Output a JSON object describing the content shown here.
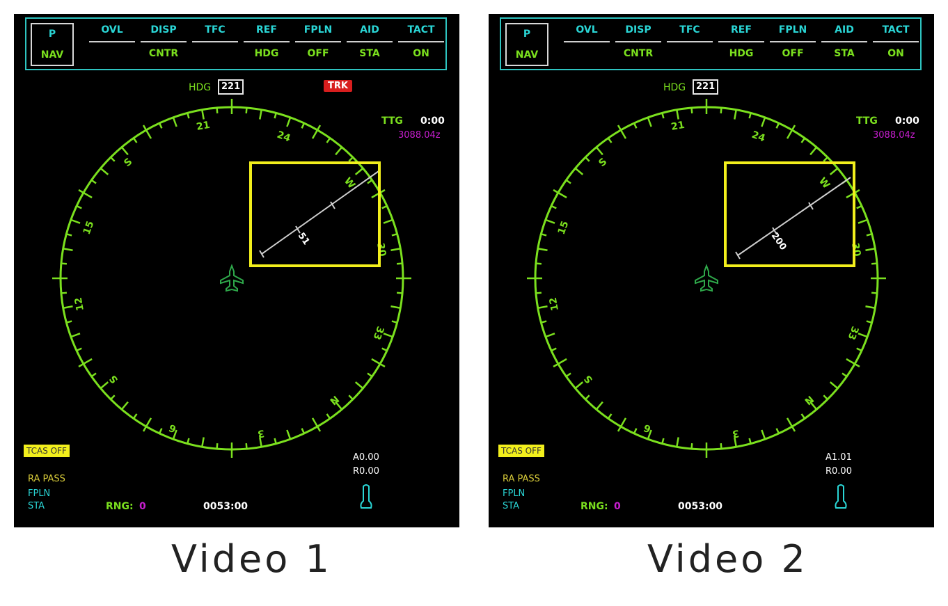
{
  "panels": [
    {
      "menu": {
        "p": "P",
        "nav": "NAV",
        "top": [
          "OVL",
          "DISP",
          "TFC",
          "REF",
          "FPLN",
          "AID",
          "TACT"
        ],
        "bottom": [
          "",
          "CNTR",
          "",
          "HDG",
          "OFF",
          "STA",
          "ON"
        ]
      },
      "hdg_label": "HDG",
      "hdg_value": "221",
      "trk": "TRK",
      "ttg_label": "TTG",
      "ttg_value": "0:00",
      "time_magenta": "3088.04z",
      "route_label": "51",
      "compass_labels": [
        "21",
        "24",
        "W",
        "30",
        "33",
        "N",
        "3",
        "6",
        "S",
        "12",
        "15",
        "S"
      ],
      "tcas": "TCAS OFF",
      "ra_pass": "RA PASS",
      "fpln": "FPLN",
      "sta": "STA",
      "rng_label": "RNG:",
      "rng_value": "0",
      "clock": "0053:00",
      "a_value": "A0.00",
      "r_value": "R0.00",
      "caption": "Video 1"
    },
    {
      "menu": {
        "p": "P",
        "nav": "NAV",
        "top": [
          "OVL",
          "DISP",
          "TFC",
          "REF",
          "FPLN",
          "AID",
          "TACT"
        ],
        "bottom": [
          "",
          "CNTR",
          "",
          "HDG",
          "OFF",
          "STA",
          "ON"
        ]
      },
      "hdg_label": "HDG",
      "hdg_value": "221",
      "trk": "",
      "ttg_label": "TTG",
      "ttg_value": "0:00",
      "time_magenta": "3088.04z",
      "route_label": "200",
      "compass_labels": [
        "21",
        "24",
        "W",
        "30",
        "33",
        "N",
        "3",
        "6",
        "S",
        "12",
        "15",
        "S"
      ],
      "tcas": "TCAS OFF",
      "ra_pass": "RA PASS",
      "fpln": "FPLN",
      "sta": "STA",
      "rng_label": "RNG:",
      "rng_value": "0",
      "clock": "0053:00",
      "a_value": "A1.01",
      "r_value": "R0.00",
      "caption": "Video 2"
    }
  ],
  "colors": {
    "compass": "#7be01e",
    "menu_border": "#2ec4c0",
    "highlight_box": "#f2ef1c",
    "magenta": "#c81ed0",
    "trk_bg": "#d81e1e"
  }
}
